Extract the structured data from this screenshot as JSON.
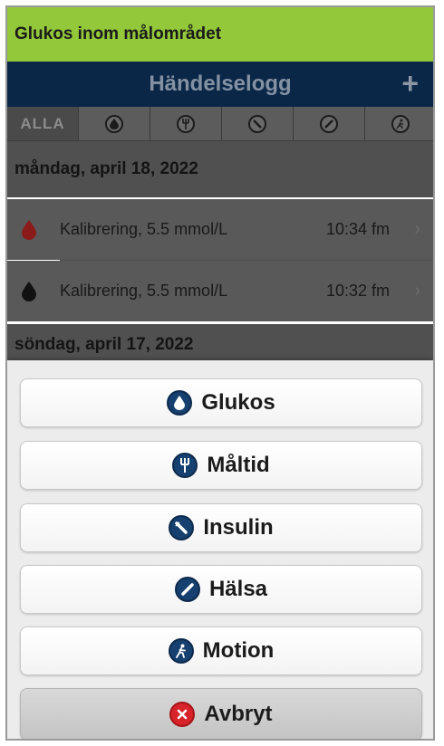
{
  "status": {
    "text": "Glukos inom målområdet",
    "color": "#93c83a"
  },
  "nav": {
    "title": "Händelselogg",
    "add_label": "+"
  },
  "filter_tabs": [
    {
      "label": "ALLA"
    },
    {
      "icon": "glucose-drop-icon"
    },
    {
      "icon": "meal-icon"
    },
    {
      "icon": "insulin-icon"
    },
    {
      "icon": "health-icon"
    },
    {
      "icon": "exercise-icon"
    }
  ],
  "log": {
    "days": [
      {
        "date": "måndag, april 18, 2022",
        "events": [
          {
            "text": "Kalibrering, 5.5 mmol/L",
            "time": "10:34 fm",
            "icon": "red-drop-icon",
            "color": "#8b1a1a"
          },
          {
            "text": "Kalibrering, 5.5 mmol/L",
            "time": "10:32 fm",
            "icon": "black-drop-icon",
            "color": "#111111"
          }
        ]
      },
      {
        "date": "söndag, april 17, 2022",
        "events": []
      }
    ]
  },
  "action_sheet": {
    "buttons": [
      {
        "label": "Glukos",
        "icon": "glucose-icon"
      },
      {
        "label": "Måltid",
        "icon": "meal-icon"
      },
      {
        "label": "Insulin",
        "icon": "insulin-icon"
      },
      {
        "label": "Hälsa",
        "icon": "health-icon"
      },
      {
        "label": "Motion",
        "icon": "exercise-icon"
      },
      {
        "label": "Avbryt",
        "icon": "cancel-icon"
      }
    ]
  }
}
